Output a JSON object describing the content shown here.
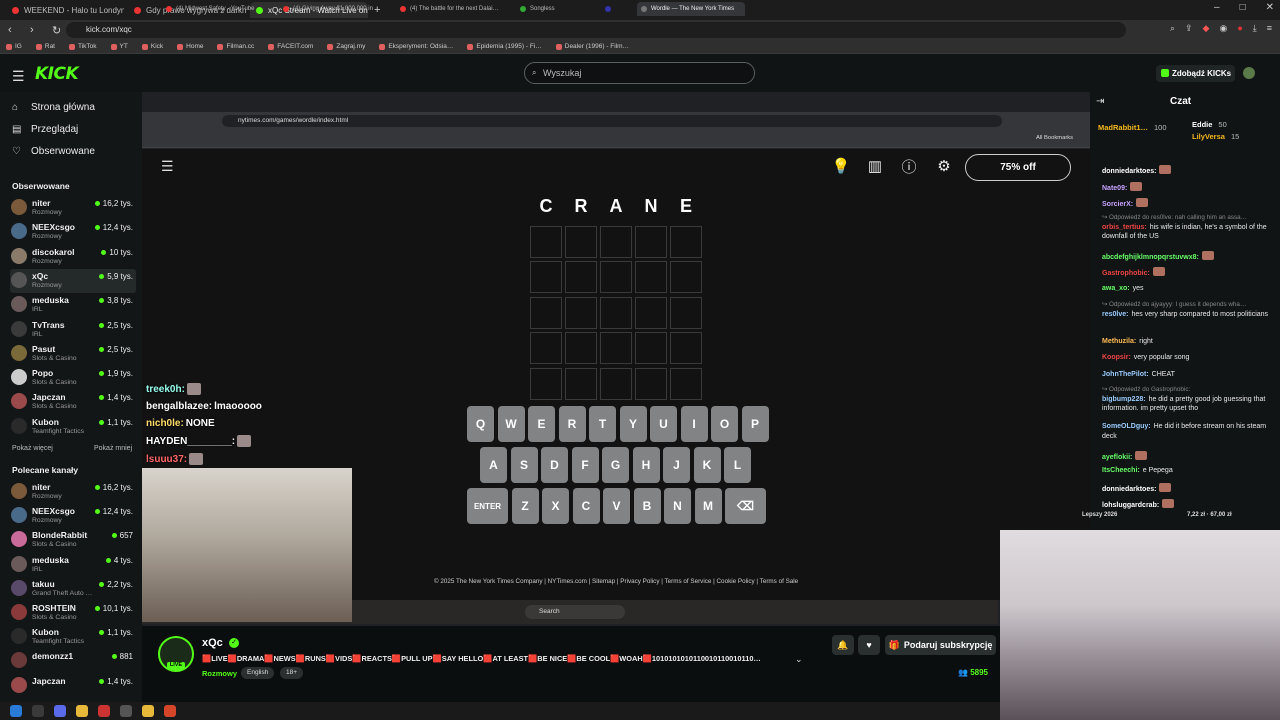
{
  "browser": {
    "tabs": [
      {
        "label": "WEEKEND - Halo tu Londyn (Oficjaln…",
        "color": "#e33"
      },
      {
        "label": "Gdy prawo wygrywa z darknetem - Y…",
        "color": "#e33"
      },
      {
        "label": "xQc Stream - Watch Live on K…",
        "color": "#53fc18"
      }
    ],
    "url": "kick.com/xqc",
    "bookmarks": [
      "IG",
      "Rat",
      "TikTok",
      "YT",
      "Kick",
      "Home",
      "Filman.cc",
      "FACEIT.com",
      "Zagraj.my",
      "Eksperyment: Odsia…",
      "Epidemia (1995) - Fi…",
      "Dealer (1996) - Film…"
    ]
  },
  "kick": {
    "search_placeholder": "Wyszukaj",
    "kicks_button": "Zdobądź KICKs"
  },
  "sidebar": {
    "nav": [
      {
        "label": "Strona główna",
        "icon": "home-icon"
      },
      {
        "label": "Przeglądaj",
        "icon": "browse-icon"
      },
      {
        "label": "Obserwowane",
        "icon": "heart-icon"
      }
    ],
    "followed_heading": "Obserwowane",
    "followed": [
      {
        "name": "niter",
        "category": "Rozmowy",
        "viewers": "16,2 tys.",
        "color": "#7a5a3a"
      },
      {
        "name": "NEEXcsgo",
        "category": "Rozmowy",
        "viewers": "12,4 tys.",
        "color": "#4a6a8a"
      },
      {
        "name": "discokarol",
        "category": "Rozmowy",
        "viewers": "10 tys.",
        "color": "#8a7a6a"
      },
      {
        "name": "xQc",
        "category": "Rozmowy",
        "viewers": "5,9 tys.",
        "color": "#555"
      },
      {
        "name": "meduska",
        "category": "IRL",
        "viewers": "3,8 tys.",
        "color": "#6a5a5a"
      },
      {
        "name": "TvTrans",
        "category": "IRL",
        "viewers": "2,5 tys.",
        "color": "#3a3a3a"
      },
      {
        "name": "Pasut",
        "category": "Slots & Casino",
        "viewers": "2,5 tys.",
        "color": "#7a6a3a"
      },
      {
        "name": "Popo",
        "category": "Slots & Casino",
        "viewers": "1,9 tys.",
        "color": "#ccc"
      },
      {
        "name": "Japczan",
        "category": "Slots & Casino",
        "viewers": "1,4 tys.",
        "color": "#9a4a4a"
      },
      {
        "name": "Kubon",
        "category": "Teamfight Tactics",
        "viewers": "1,1 tys.",
        "color": "#2a2a2a"
      }
    ],
    "show_more": "Pokaż więcej",
    "show_less": "Pokaż mniej",
    "recommended_heading": "Polecane kanały",
    "recommended": [
      {
        "name": "niter",
        "category": "Rozmowy",
        "viewers": "16,2 tys.",
        "color": "#7a5a3a"
      },
      {
        "name": "NEEXcsgo",
        "category": "Rozmowy",
        "viewers": "12,4 tys.",
        "color": "#4a6a8a"
      },
      {
        "name": "BlondeRabbit",
        "category": "Slots & Casino",
        "viewers": "657",
        "color": "#c86a9a"
      },
      {
        "name": "meduska",
        "category": "IRL",
        "viewers": "4 tys.",
        "color": "#6a5a5a"
      },
      {
        "name": "takuu",
        "category": "Grand Theft Auto …",
        "viewers": "2,2 tys.",
        "color": "#5a4a6a"
      },
      {
        "name": "ROSHTEIN",
        "category": "Slots & Casino",
        "viewers": "10,1 tys.",
        "color": "#8a3a3a"
      },
      {
        "name": "Kubon",
        "category": "Teamfight Tactics",
        "viewers": "1,1 tys.",
        "color": "#2a2a2a"
      },
      {
        "name": "demonzz1",
        "category": "",
        "viewers": "881",
        "color": "#6a3a3a"
      },
      {
        "name": "Japczan",
        "category": "",
        "viewers": "1,4 tys.",
        "color": "#9a4a4a"
      }
    ]
  },
  "inner_browser": {
    "tabs": [
      {
        "label": "(4) Midwest Safety - YouTube",
        "color": "#e33"
      },
      {
        "label": "(4) Giving Away $1,000,000 in …",
        "color": "#e33"
      },
      {
        "label": "(4) The battle for the next Dalai…",
        "color": "#e33"
      },
      {
        "label": "Songless",
        "color": "#3a3"
      },
      {
        "label": "",
        "color": "#33a"
      },
      {
        "label": "Wordle — The New York Times",
        "color": "#777"
      }
    ],
    "url": "nytimes.com/games/wordle/index.html",
    "all_bookmarks": "All Bookmarks"
  },
  "wordle": {
    "promo_label": "75% off",
    "guess_row": [
      "C",
      "R",
      "A",
      "N",
      "E"
    ],
    "keyboard": [
      [
        "Q",
        "W",
        "E",
        "R",
        "T",
        "Y",
        "U",
        "I",
        "O",
        "P"
      ],
      [
        "A",
        "S",
        "D",
        "F",
        "G",
        "H",
        "J",
        "K",
        "L"
      ],
      [
        "ENTER",
        "Z",
        "X",
        "C",
        "V",
        "B",
        "N",
        "M",
        "⌫"
      ]
    ],
    "footer": "© 2025 The New York Times Company  |  NYTimes.com  |  Sitemap  |  Privacy Policy  |  Terms of Service  |  Cookie Policy  |  Terms of Sale",
    "taskbar_search": "Search"
  },
  "overlay_chat": [
    {
      "user": "treek0h:",
      "text": "",
      "color": "#9fe"
    },
    {
      "user": "bengalblazee:",
      "text": "lmaooooo",
      "color": "#fff"
    },
    {
      "user": "nich0le:",
      "text": "NONE",
      "color": "#fd6"
    },
    {
      "user": "HAYDEN________:",
      "text": "",
      "color": "#fff"
    },
    {
      "user": "lsuuu37:",
      "text": "",
      "color": "#f66"
    }
  ],
  "channel": {
    "name": "xQc",
    "live": "LIVE",
    "title": "🟥LIVE🟥DRAMA🟥NEWS🟥RUNS🟥VIDS🟥REACTS🟥PULL UP🟥SAY HELLO🟥AT LEAST🟥BE NICE🟥BE COOL🟥WOAH🟥1010101010110010110010110…",
    "category": "Rozmowy",
    "tags": [
      "English",
      "18+"
    ],
    "subscribe": "Podaruj subskrypcję",
    "viewers": "5895"
  },
  "chat": {
    "title": "Czat",
    "gifters": [
      {
        "name": "MadRabbit1…",
        "count": "100",
        "color": "#f5b81c"
      },
      {
        "name": "Eddie",
        "count": "50",
        "color": "#fff"
      },
      {
        "name": "LilyVersa",
        "count": "15",
        "color": "#f5b81c"
      }
    ],
    "messages": [
      {
        "reply": "",
        "user": "donniedarktoes:",
        "ucolor": "#fff",
        "text": "",
        "emote": true
      },
      {
        "reply": "",
        "user": "Nate09:",
        "ucolor": "#c7a3ff",
        "text": "",
        "emote": true
      },
      {
        "reply": "",
        "user": "SorcierX:",
        "ucolor": "#c7a3ff",
        "text": "",
        "emote": true
      },
      {
        "reply": "↪ Odpowiedź do res0lve: nah calling him an assa…",
        "user": "orbis_tertius:",
        "ucolor": "#e44",
        "text": "his wife is indian, he's a symbol of the downfall of the US",
        "emote": false
      },
      {
        "reply": "",
        "user": "abcdefghijklmnopqrstuvwx8:",
        "ucolor": "#6f6",
        "text": "",
        "emote": true
      },
      {
        "reply": "",
        "user": "Gastrophobic:",
        "ucolor": "#e44",
        "text": "",
        "emote": true
      },
      {
        "reply": "",
        "user": "awa_xo:",
        "ucolor": "#6f6",
        "text": "yes",
        "emote": false
      },
      {
        "reply": "↪ Odpowiedź do ajyayyy: I guess it depends wha…",
        "user": "res0lve:",
        "ucolor": "#9cf",
        "text": "hes very sharp compared to most politicians",
        "emote": false
      },
      {
        "reply": "",
        "user": "Methuzila:",
        "ucolor": "#fb5",
        "text": "right",
        "emote": false
      },
      {
        "reply": "",
        "user": "Koopsir:",
        "ucolor": "#e44",
        "text": "very popular song",
        "emote": false
      },
      {
        "reply": "",
        "user": "JohnThePilot:",
        "ucolor": "#9cf",
        "text": "CHEAT",
        "emote": false
      },
      {
        "reply": "↪ Odpowiedź do Gastrophobic:",
        "user": "bigbump228:",
        "ucolor": "#9cf",
        "text": "he did a pretty good job guessing that information. im pretty upset tho",
        "emote": false
      },
      {
        "reply": "",
        "user": "SomeOLDguy:",
        "ucolor": "#9cf",
        "text": "He did it before stream on his steam deck",
        "emote": false
      },
      {
        "reply": "",
        "user": "ayeflokii:",
        "ucolor": "#6f6",
        "text": "",
        "emote": true
      },
      {
        "reply": "",
        "user": "ItsCheechi:",
        "ucolor": "#6f6",
        "text": "e Pepega",
        "emote": false
      },
      {
        "reply": "",
        "user": "donniedarktoes:",
        "ucolor": "#fff",
        "text": "",
        "emote": true
      },
      {
        "reply": "",
        "user": "lohsluggardcrab:",
        "ucolor": "#fff",
        "text": "",
        "emote": true
      }
    ],
    "promo_text": "Lepszy 2026",
    "promo_price": "7,22 zł · 67,00 zł"
  }
}
